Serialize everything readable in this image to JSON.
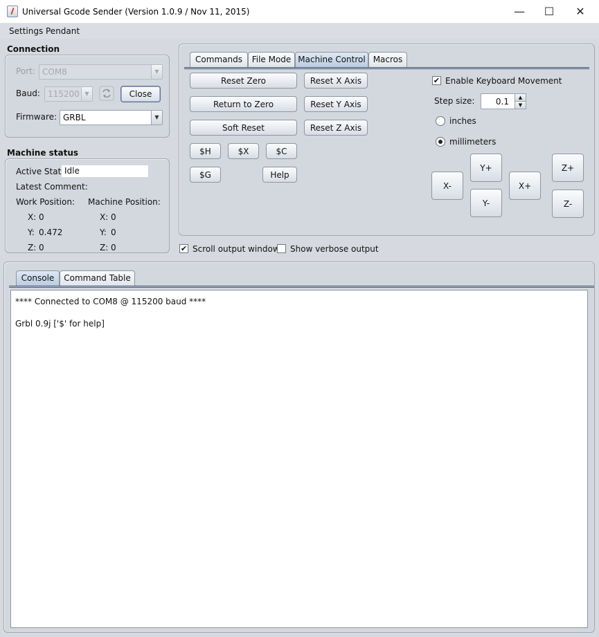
{
  "window": {
    "title": "Universal Gcode Sender (Version 1.0.9 / Nov 11, 2015)",
    "minimize": "—",
    "maximize": "☐",
    "close": "✕"
  },
  "menu": {
    "settings": "Settings",
    "pendant": "Pendant"
  },
  "connection": {
    "title": "Connection",
    "port_label": "Port:",
    "port_value": "COM8",
    "baud_label": "Baud:",
    "baud_value": "115200",
    "close_button": "Close",
    "firmware_label": "Firmware:",
    "firmware_value": "GRBL"
  },
  "machine_status": {
    "title": "Machine status",
    "active_state_label": "Active State:",
    "active_state_value": "Idle",
    "latest_comment_label": "Latest Comment:",
    "work_position_label": "Work Position:",
    "machine_position_label": "Machine Position:",
    "work": {
      "x_label": "X:",
      "x": "0",
      "y_label": "Y:",
      "y": "0.472",
      "z_label": "Z:",
      "z": "0"
    },
    "machine": {
      "x_label": "X:",
      "x": "0",
      "y_label": "Y:",
      "y": "0",
      "z_label": "Z:",
      "z": "0"
    }
  },
  "tabs": {
    "commands": "Commands",
    "file_mode": "File Mode",
    "machine_control": "Machine Control",
    "macros": "Macros"
  },
  "machine_control": {
    "reset_zero": "Reset Zero",
    "return_to_zero": "Return to Zero",
    "soft_reset": "Soft Reset",
    "reset_x_axis": "Reset X Axis",
    "reset_y_axis": "Reset Y Axis",
    "reset_z_axis": "Reset Z Axis",
    "h": "$H",
    "x": "$X",
    "c": "$C",
    "g": "$G",
    "help": "Help",
    "enable_keyboard": "Enable Keyboard Movement",
    "step_size_label": "Step size:",
    "step_size_value": "0.1",
    "inches": "inches",
    "millimeters": "millimeters",
    "jog": {
      "x_minus": "X-",
      "x_plus": "X+",
      "y_plus": "Y+",
      "y_minus": "Y-",
      "z_plus": "Z+",
      "z_minus": "Z-"
    }
  },
  "options": {
    "scroll_output": "Scroll output window",
    "show_verbose": "Show verbose output"
  },
  "console": {
    "tab_console": "Console",
    "tab_command_table": "Command Table",
    "lines": [
      "**** Connected to COM8 @ 115200 baud ****",
      "Grbl 0.9j ['$' for help]"
    ]
  }
}
